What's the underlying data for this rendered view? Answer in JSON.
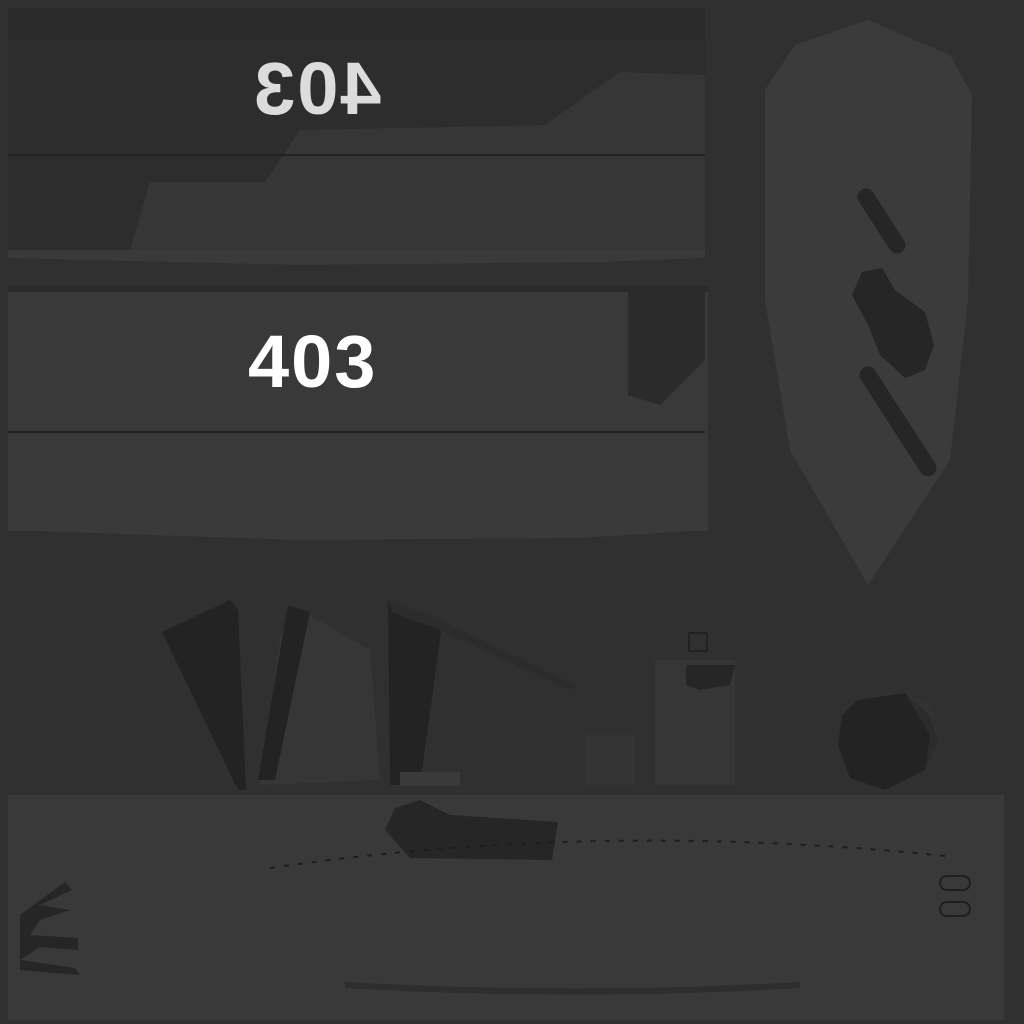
{
  "texture": {
    "top_label_mirrored": "403",
    "middle_label": "403"
  },
  "colors": {
    "background": "#303030",
    "panel": "#3a3a3a",
    "shadow": "#262626",
    "label": "#ffffff"
  }
}
